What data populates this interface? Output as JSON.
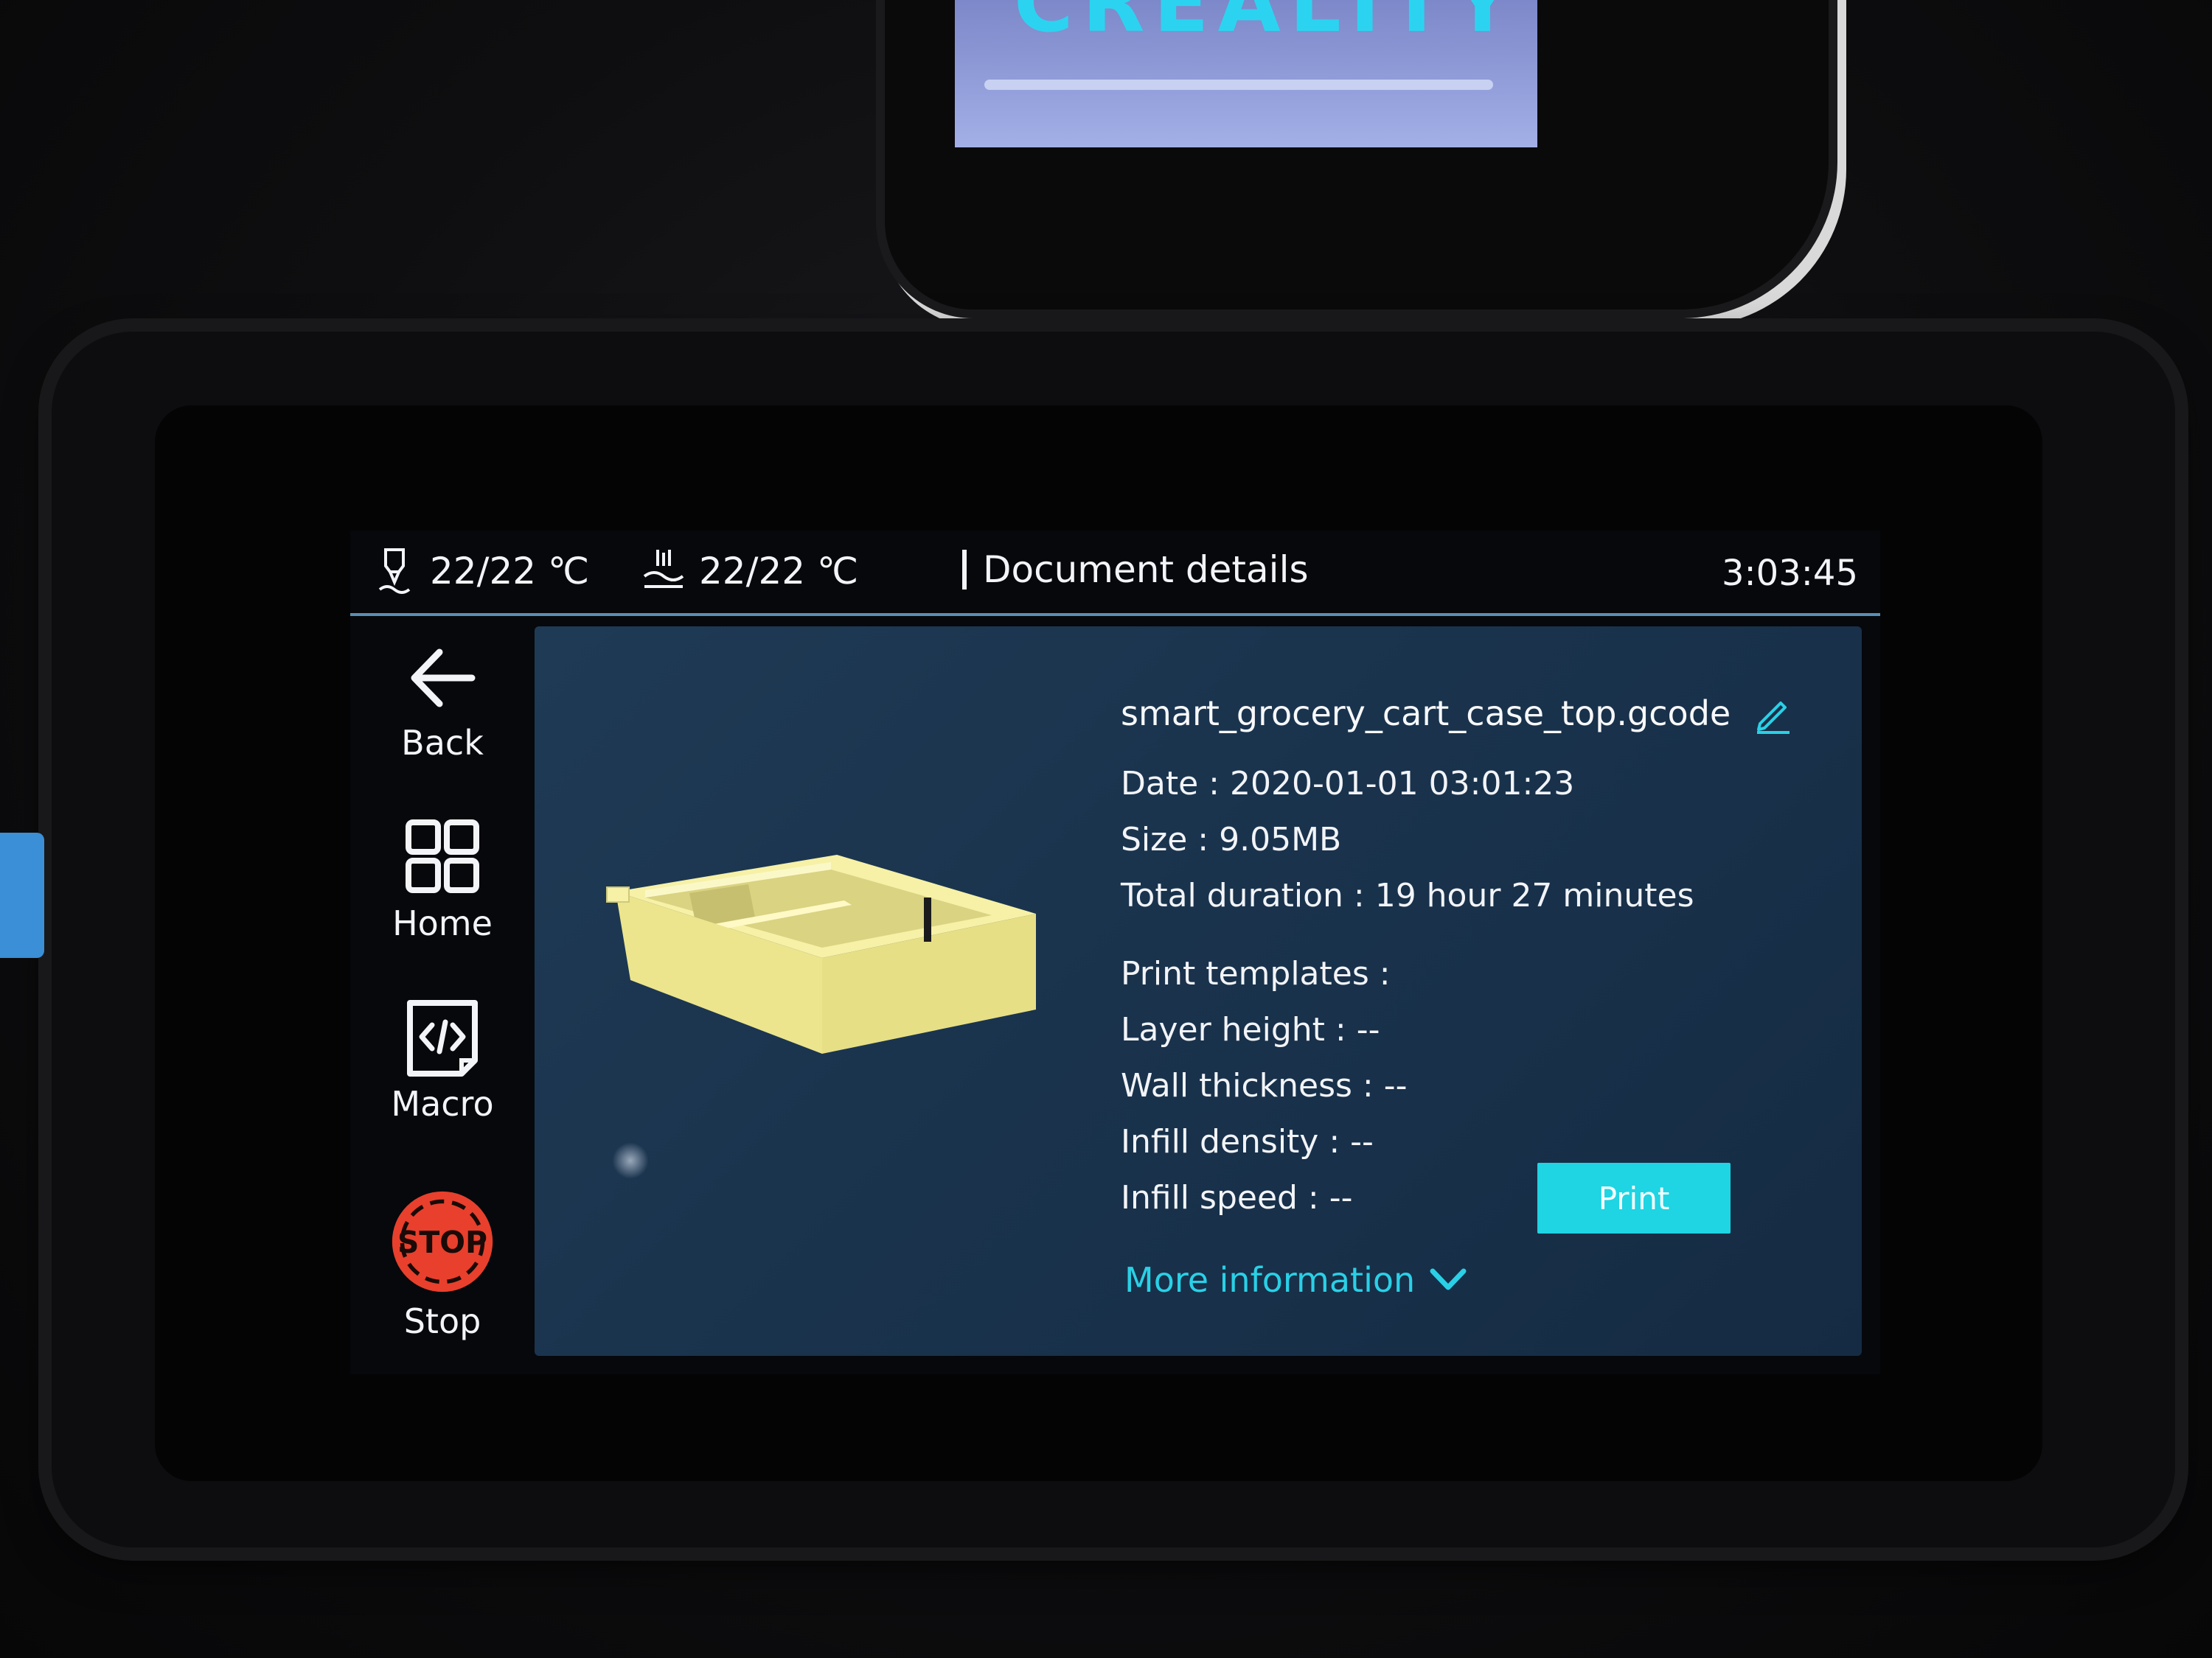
{
  "background": {
    "upper_device_logo": "CREALITY"
  },
  "status_bar": {
    "nozzle_temp": "22/22 ℃",
    "bed_temp": "22/22 ℃",
    "title": "Document details",
    "time": "3:03:45"
  },
  "sidebar": {
    "items": [
      {
        "label": "Back",
        "icon": "arrow-left-icon"
      },
      {
        "label": "Home",
        "icon": "grid-icon"
      },
      {
        "label": "Macro",
        "icon": "code-file-icon"
      },
      {
        "label": "Stop",
        "icon": "stop-icon"
      }
    ]
  },
  "file": {
    "name": "smart_grocery_cart_case_top.gcode",
    "date": "Date : 2020-01-01 03:01:23",
    "size": "Size : 9.05MB",
    "duration": "Total duration : 19 hour 27 minutes"
  },
  "templates": {
    "heading": "Print templates :",
    "layer_height": "Layer height : --",
    "wall_thickness": "Wall thickness : --",
    "infill_density": "Infill density : --",
    "infill_speed": "Infill speed : --"
  },
  "actions": {
    "more_info": "More information",
    "print": "Print"
  },
  "colors": {
    "accent": "#1fd4e3",
    "panel": "#1f3a55",
    "stop": "#e8402c",
    "model": "#f2eb9a"
  }
}
